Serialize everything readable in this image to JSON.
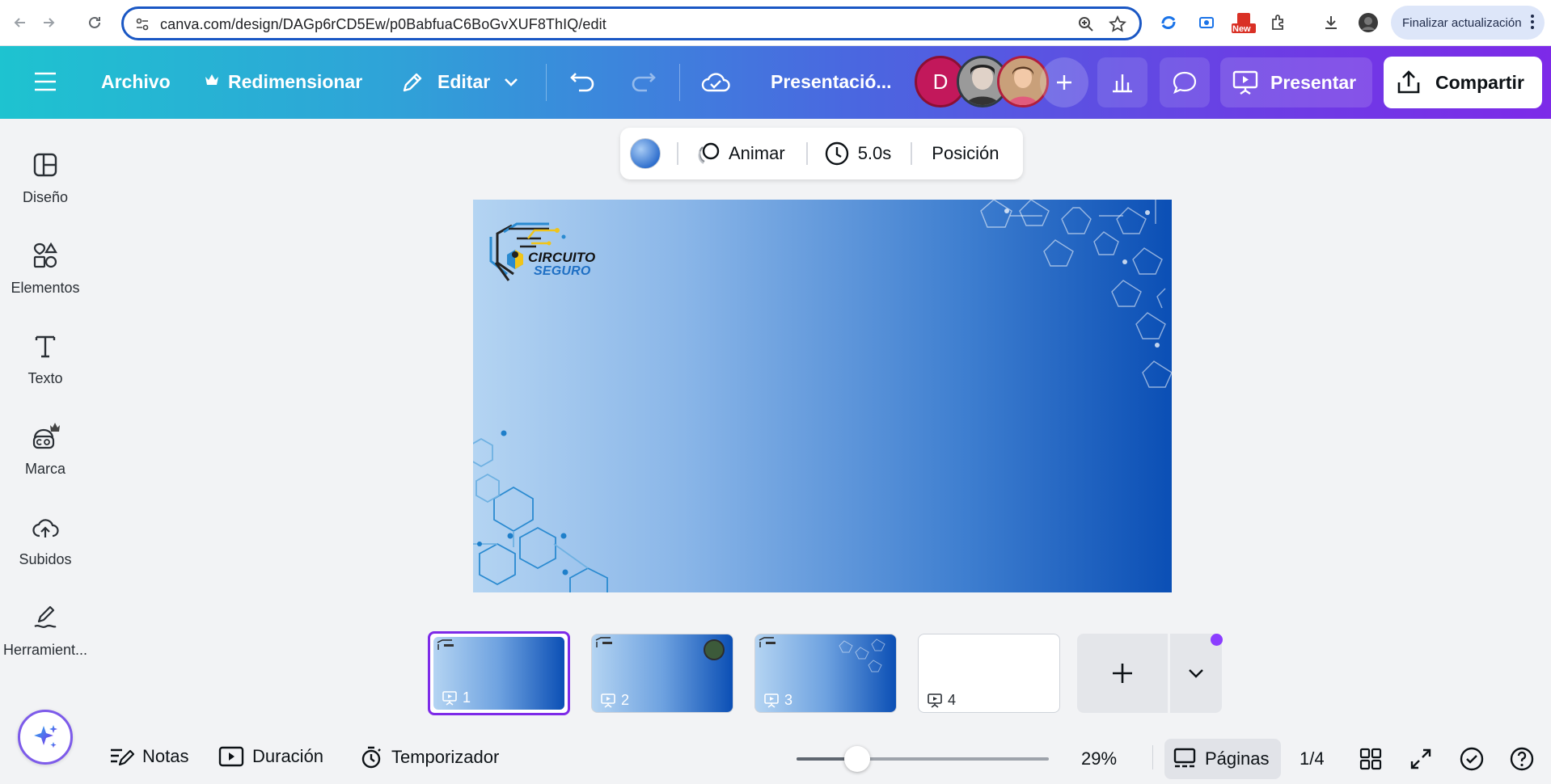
{
  "browser": {
    "url": "canva.com/design/DAGp6rCD5Ew/p0BabfuaC6BoGvXUF8ThIQ/edit",
    "new_badge": "New",
    "update_label": "Finalizar actualización"
  },
  "header": {
    "menu_icon": "hamburger-icon",
    "file_label": "Archivo",
    "resize_label": "Redimensionar",
    "edit_label": "Editar",
    "title": "Presentació...",
    "avatar_initial": "D",
    "present_label": "Presentar",
    "share_label": "Compartir",
    "colors": {
      "avatar_bg": "#c2185b",
      "share_bg": "#ffffff"
    }
  },
  "sidebar": {
    "items": [
      {
        "label": "Diseño",
        "icon": "layout-icon"
      },
      {
        "label": "Elementos",
        "icon": "shapes-icon"
      },
      {
        "label": "Texto",
        "icon": "text-icon"
      },
      {
        "label": "Marca",
        "icon": "brand-icon"
      },
      {
        "label": "Subidos",
        "icon": "upload-cloud-icon"
      },
      {
        "label": "Herramient...",
        "icon": "tools-icon"
      }
    ]
  },
  "toolbar": {
    "animate_label": "Animar",
    "duration_label": "5.0s",
    "position_label": "Posición"
  },
  "slide": {
    "logo_line1": "CIRCUITO",
    "logo_line2": "SEGURO"
  },
  "thumbnails": [
    {
      "num": "1"
    },
    {
      "num": "2"
    },
    {
      "num": "3"
    },
    {
      "num": "4"
    }
  ],
  "bottom": {
    "notes_label": "Notas",
    "duration_label": "Duración",
    "timer_label": "Temporizador",
    "zoom": "29%",
    "zoom_value": 0.24,
    "pages_label": "Páginas",
    "page_count": "1/4"
  }
}
